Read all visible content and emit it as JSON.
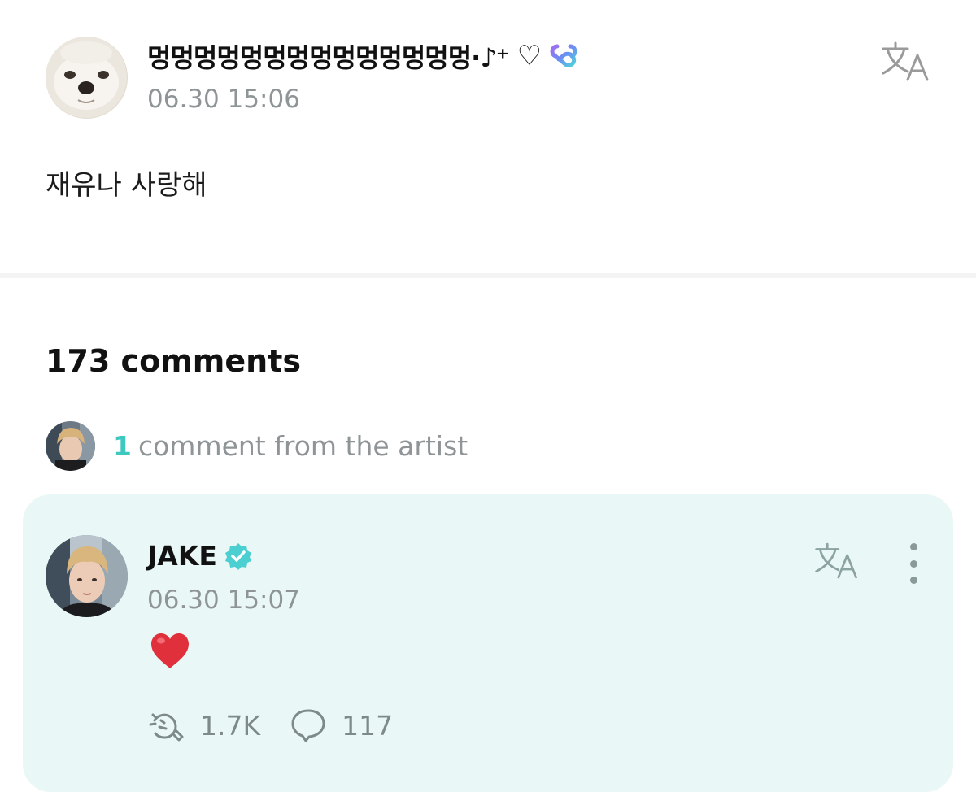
{
  "post": {
    "author_name": "멍멍멍멍멍멍멍멍멍멍멍멍멍멍·♪⁺",
    "author_heart": "♡",
    "time": "06.30 15:06",
    "body": "재유나 사랑해"
  },
  "comments": {
    "count_label": "173 comments",
    "artist_count": "1",
    "artist_label": "comment from the artist"
  },
  "artist_comment": {
    "author": "JAKE",
    "time": "06.30 15:07",
    "body": "❤️",
    "likes": "1.7K",
    "replies": "117"
  },
  "colors": {
    "accent": "#3fc8c0",
    "card_background": "#e9f8f6",
    "muted_text": "#8f9497"
  },
  "icons": {
    "membership_badge": "gradient-loop-icon",
    "verified_badge": "verified-check-icon",
    "translate": "translate-icon",
    "more": "more-vertical-icon",
    "like": "cheer-icon",
    "reply": "speech-bubble-icon"
  }
}
